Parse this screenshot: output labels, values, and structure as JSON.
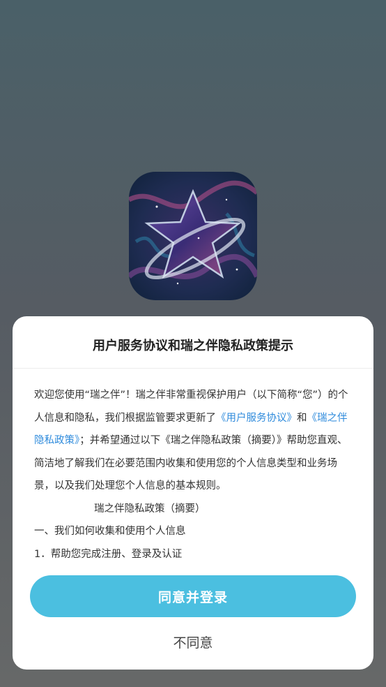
{
  "dialog": {
    "title": "用户服务协议和瑞之伴隐私政策提示",
    "intro_1": "欢迎您使用“瑞之伴”！瑞之伴非常重视保护用户（以下简称“您”）的个人信息和隐私，我们根据监管要求更新了",
    "link_user_agreement": "《用户服务协议》",
    "and": "和",
    "link_privacy_policy": "《瑞之伴隐私政策》",
    "intro_2": "；并希望通过以下《瑞之伴隐私政策（摘要）》帮助您直观、简洁地了解我们在必要范围内收集和使用您的个人信息类型和业务场景，以及我们处理您个人信息的基本规则。",
    "summary_title": "瑞之伴隐私政策（摘要）",
    "section_1": "一、我们如何收集和使用个人信息",
    "item_1": "1．帮助您完成注册、登录及认证",
    "agree_button": "同意并登录",
    "disagree_button": "不同意"
  },
  "colors": {
    "accent": "#4bbfe0",
    "link": "#2f8bdc"
  },
  "icon": "app-logo-icon"
}
